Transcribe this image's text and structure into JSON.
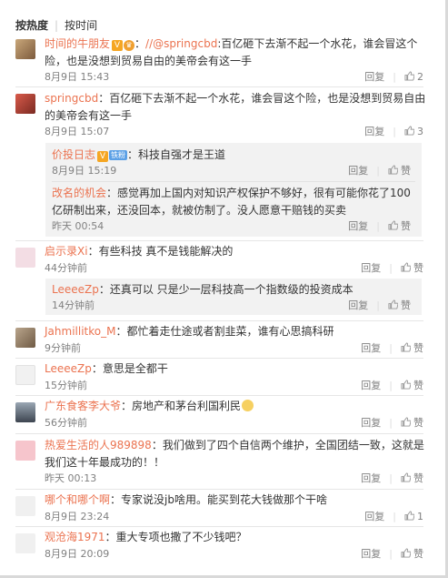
{
  "sort": {
    "hot": "按热度",
    "time": "按时间"
  },
  "actions": {
    "reply": "回复",
    "like": "赞"
  },
  "comments": [
    {
      "user": "时间的牛朋友",
      "at": "//@springcbd",
      "text1": ":百亿砸下去渐不起一个水花，谁会冒这个",
      "text2": "险，也是没想到贸易自由的美帝会有这一手",
      "time": "8月9日 15:43",
      "likes": "2"
    },
    {
      "user": "springcbd",
      "text1": "：百亿砸下去渐不起一个水花，谁会冒这个险，也是没想到贸易自由",
      "text2": "的美帝会有这一手",
      "time": "8月9日 15:07",
      "likes": "3",
      "replies": [
        {
          "user": "价投日志",
          "badge": "铁粉",
          "text1": "：科技自强才是王道",
          "time": "8月9日 15:19"
        },
        {
          "user": "改名的机会",
          "text1": "：感觉再加上国内对知识产权保护不够好，很有可能你花了100",
          "text2": "亿研制出来，还没回本，就被仿制了。没人愿意干赔钱的买卖",
          "time": "昨天 00:54"
        }
      ]
    },
    {
      "user": "启示录Xi",
      "text1": "：有些科技 真不是钱能解决的",
      "time": "44分钟前",
      "replies": [
        {
          "user": "LeeeeZp",
          "text1": "：还真可以 只是少一层科技高一个指数级的投资成本",
          "time": "14分钟前"
        }
      ]
    },
    {
      "user": "Jahmillitko_M",
      "text1": "：都忙着走仕途或者割韭菜，谁有心思搞科研",
      "time": "9分钟前"
    },
    {
      "user": "LeeeeZp",
      "text1": "：意思是全都干",
      "time": "15分钟前"
    },
    {
      "user": "广东食客李大爷",
      "text1": "：房地产和茅台利国利民",
      "time": "56分钟前"
    },
    {
      "user": "热爱生活的人989898",
      "text1": "：我们做到了四个自信两个维护，全国团结一致，这就是",
      "text2": "我们这十年最成功的！！",
      "time": "昨天 00:13"
    },
    {
      "user": "哪个和哪个啊",
      "text1": "：专家说没jb啥用。能买到花大钱做那个干啥",
      "time": "8月9日 23:24",
      "likes": "1"
    },
    {
      "user": "观沧海1971",
      "text1": "：重大专项也撒了不少钱吧？",
      "time": "8月9日 20:09"
    }
  ]
}
